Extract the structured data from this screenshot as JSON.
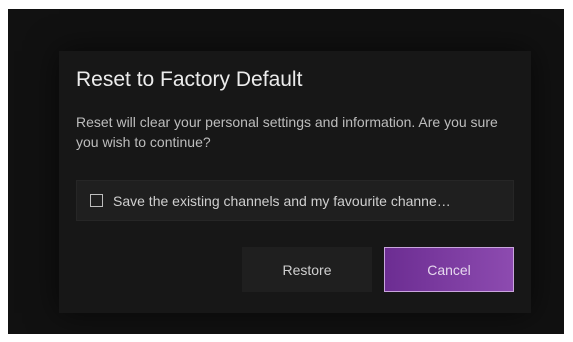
{
  "dialog": {
    "title": "Reset to Factory Default",
    "message": "Reset will clear your personal settings and information. Are you sure you wish to continue?",
    "option": {
      "label": "Save the existing channels and my favourite channe…",
      "checked": false
    },
    "buttons": {
      "restore_label": "Restore",
      "cancel_label": "Cancel"
    }
  },
  "colors": {
    "background": "#111111",
    "panel": "#171717",
    "accent_start": "#6c2d92",
    "accent_end": "#8d4bb0"
  }
}
